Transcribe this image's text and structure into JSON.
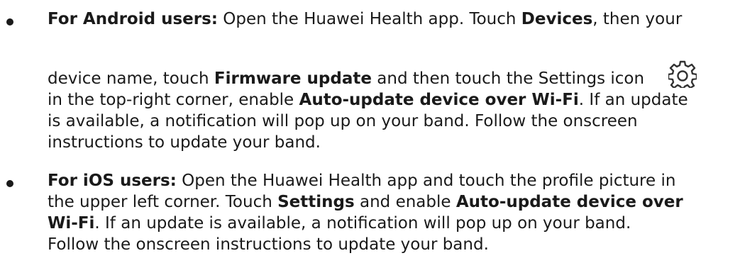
{
  "android": {
    "heading": "For Android users:",
    "l1_a": " Open the Huawei Health app. Touch ",
    "l1_b": "Devices",
    "l1_c": ", then your",
    "l2_a": "device name, touch ",
    "l2_b": "Firmware update",
    "l2_c": " and then touch the Settings icon",
    "l3_a": "in the top-right corner, enable ",
    "l3_b": "Auto-update device over Wi-Fi",
    "l3_c": ". If an update",
    "l4": "is available, a notification will pop up on your band. Follow the onscreen",
    "l5": "instructions to update your band.",
    "icon": "settings-gear-icon"
  },
  "ios": {
    "heading": "For iOS users:",
    "l1_a": " Open the Huawei Health app and touch the profile picture in",
    "l2_a": "the upper left corner. Touch ",
    "l2_b": "Settings",
    "l2_c": " and enable ",
    "l2_d": "Auto-update device over",
    "l3_a": "Wi-Fi",
    "l3_b": ". If an update is available, a notification will pop up on your band.",
    "l4": "Follow the onscreen instructions to update your band."
  }
}
